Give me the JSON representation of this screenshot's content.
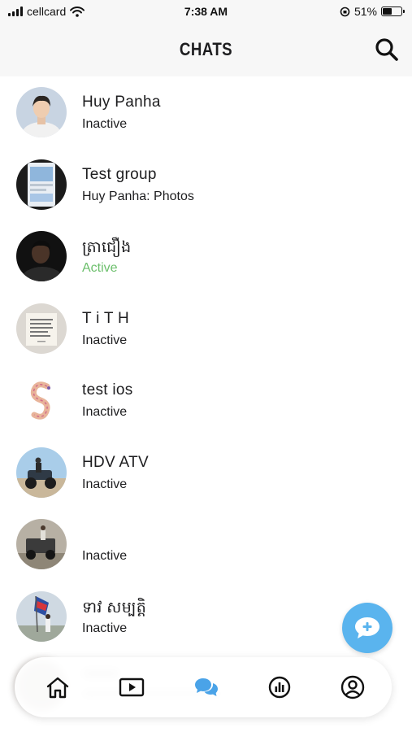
{
  "status_bar": {
    "carrier": "cellcard",
    "time": "7:38 AM",
    "battery_percent": "51%",
    "battery_level": 0.51
  },
  "header": {
    "title": "CHATS",
    "search_icon": "search-icon"
  },
  "chats": [
    {
      "name": "Huy Panha",
      "status": "Inactive",
      "avatar": "portrait-photo"
    },
    {
      "name": "Test group",
      "status": "Huy Panha: Photos",
      "avatar": "phone-screenshot"
    },
    {
      "name": "ត្រាជឿង",
      "status": "Active",
      "avatar": "dark-portrait"
    },
    {
      "name": "T i T H",
      "status": "Inactive",
      "avatar": "text-card"
    },
    {
      "name": "test ios",
      "status": "Inactive",
      "avatar": "letter-s-sticker"
    },
    {
      "name": "HDV ATV",
      "status": "Inactive",
      "avatar": "atv-photo"
    },
    {
      "name": "",
      "status": "Inactive",
      "avatar": "vehicle-photo"
    },
    {
      "name": "ទាវ សម្បត្តិ",
      "status": "Inactive",
      "avatar": "flag-photo"
    }
  ],
  "fab_icon": "new-chat-icon",
  "tabs": [
    {
      "id": "home",
      "icon": "home-icon"
    },
    {
      "id": "video",
      "icon": "play-icon"
    },
    {
      "id": "chats",
      "icon": "chat-bubbles-icon",
      "active": true
    },
    {
      "id": "stats",
      "icon": "chart-icon"
    },
    {
      "id": "profile",
      "icon": "profile-icon"
    }
  ],
  "colors": {
    "accent": "#5ab4ee",
    "active_status": "#6cbf6c",
    "tab_active": "#4aa3e8",
    "header_bg": "#f7f7f7"
  }
}
